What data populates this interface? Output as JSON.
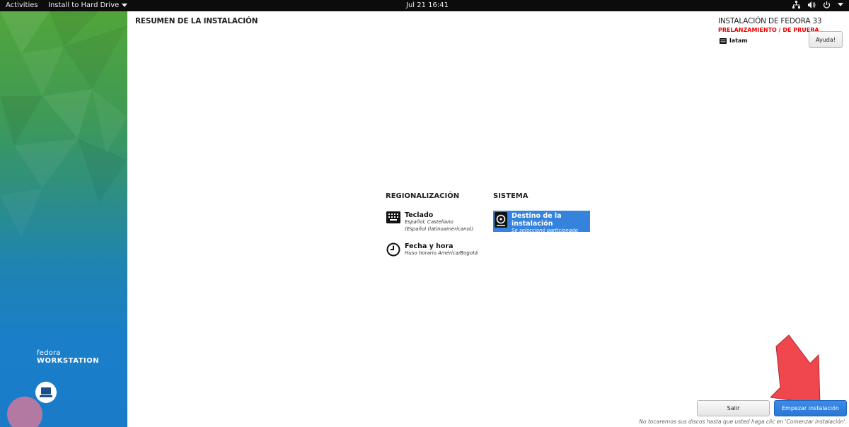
{
  "topbar": {
    "activities": "Activities",
    "app_menu": "Install to Hard Drive",
    "clock": "Jul 21  16:41"
  },
  "sidebar": {
    "brand_line1": "fedora",
    "brand_line2": "WORKSTATION"
  },
  "header": {
    "title": "RESUMEN DE LA INSTALACIÓN",
    "product": "INSTALACIÓN DE FEDORA 33",
    "prerelease": "PRELANZAMIENTO / DE PRUEBA",
    "keyboard_layout": "latam",
    "help_label": "Ayuda!"
  },
  "sections": {
    "localization": {
      "title": "REGIONALIZACIÓN",
      "keyboard": {
        "title": "Teclado",
        "status_line1": "Español; Castellano",
        "status_line2": "(Español (latinoamericano))"
      },
      "datetime": {
        "title": "Fecha y hora",
        "status_line1": "Huso horario América/Bogotá"
      }
    },
    "system": {
      "title": "SISTEMA",
      "destination": {
        "title": "Destino de la instalación",
        "status_line1": "Se seleccionó particionado",
        "status_line2": "personalizado"
      }
    }
  },
  "footer": {
    "quit_label": "Salir",
    "begin_label": "Empezar instalación",
    "note": "No tocaremos sus discos hasta que usted haga clic en 'Comenzar instalación'."
  },
  "colors": {
    "accent": "#3583dd",
    "prerelease": "#e00000",
    "arrow": "#f0474e"
  }
}
